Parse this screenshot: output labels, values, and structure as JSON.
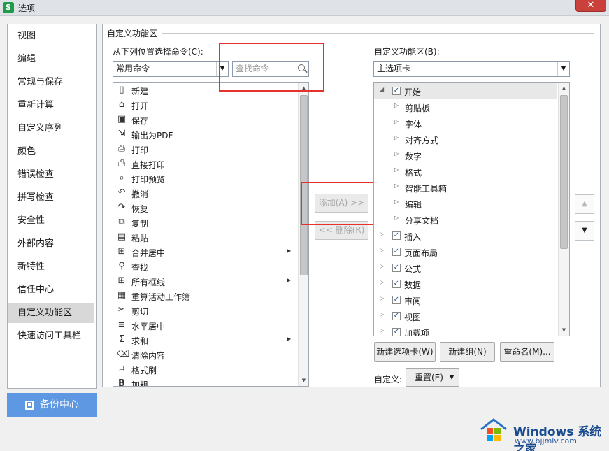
{
  "window": {
    "title": "选项",
    "app_icon": "S",
    "close": "✕"
  },
  "nav": {
    "items": [
      "视图",
      "编辑",
      "常规与保存",
      "重新计算",
      "自定义序列",
      "颜色",
      "错误检查",
      "拼写检查",
      "安全性",
      "外部内容",
      "新特性",
      "信任中心",
      "自定义功能区",
      "快速访问工具栏"
    ],
    "selected": "自定义功能区"
  },
  "backup": {
    "label": "备份中心"
  },
  "section_title": "自定义功能区",
  "left": {
    "label": "从下列位置选择命令(C):",
    "select_value": "常用命令",
    "search_placeholder": "查找命令",
    "commands": [
      {
        "label": "新建",
        "icon": "new-file-icon",
        "submenu": false
      },
      {
        "label": "打开",
        "icon": "open-folder-icon",
        "submenu": false
      },
      {
        "label": "保存",
        "icon": "save-icon",
        "submenu": false
      },
      {
        "label": "输出为PDF",
        "icon": "pdf-export-icon",
        "submenu": false
      },
      {
        "label": "打印",
        "icon": "print-icon",
        "submenu": false
      },
      {
        "label": "直接打印",
        "icon": "quick-print-icon",
        "submenu": false
      },
      {
        "label": "打印预览",
        "icon": "print-preview-icon",
        "submenu": false
      },
      {
        "label": "撤消",
        "icon": "undo-icon",
        "submenu": false
      },
      {
        "label": "恢复",
        "icon": "redo-icon",
        "submenu": false
      },
      {
        "label": "复制",
        "icon": "copy-icon",
        "submenu": false
      },
      {
        "label": "粘贴",
        "icon": "paste-icon",
        "submenu": false
      },
      {
        "label": "合并居中",
        "icon": "merge-center-icon",
        "submenu": true
      },
      {
        "label": "查找",
        "icon": "find-icon",
        "submenu": false
      },
      {
        "label": "所有框线",
        "icon": "all-borders-icon",
        "submenu": true
      },
      {
        "label": "重算活动工作簿",
        "icon": "recalculate-icon",
        "submenu": false
      },
      {
        "label": "剪切",
        "icon": "cut-icon",
        "submenu": false
      },
      {
        "label": "水平居中",
        "icon": "align-center-icon",
        "submenu": false
      },
      {
        "label": "求和",
        "icon": "sum-icon",
        "submenu": true
      },
      {
        "label": "清除内容",
        "icon": "clear-content-icon",
        "submenu": false
      },
      {
        "label": "格式刷",
        "icon": "format-painter-icon",
        "submenu": false
      },
      {
        "label": "加粗",
        "icon": "bold-icon",
        "submenu": false
      }
    ]
  },
  "middle": {
    "add_label": "添加(A) >>",
    "remove_label": "<< 删除(R)"
  },
  "right": {
    "label": "自定义功能区(B):",
    "select_value": "主选项卡",
    "tree": [
      {
        "label": "开始",
        "level": 0,
        "expanded": true,
        "checked": true,
        "highlight": true
      },
      {
        "label": "剪贴板",
        "level": 1
      },
      {
        "label": "字体",
        "level": 1
      },
      {
        "label": "对齐方式",
        "level": 1
      },
      {
        "label": "数字",
        "level": 1
      },
      {
        "label": "格式",
        "level": 1
      },
      {
        "label": "智能工具箱",
        "level": 1
      },
      {
        "label": "编辑",
        "level": 1
      },
      {
        "label": "分享文档",
        "level": 1
      },
      {
        "label": "插入",
        "level": 0,
        "expanded": false,
        "checked": true
      },
      {
        "label": "页面布局",
        "level": 0,
        "expanded": false,
        "checked": true
      },
      {
        "label": "公式",
        "level": 0,
        "expanded": false,
        "checked": true
      },
      {
        "label": "数据",
        "level": 0,
        "expanded": false,
        "checked": true
      },
      {
        "label": "审阅",
        "level": 0,
        "expanded": false,
        "checked": true
      },
      {
        "label": "视图",
        "level": 0,
        "expanded": false,
        "checked": true
      },
      {
        "label": "加载项",
        "level": 0,
        "expanded": false,
        "checked": true
      }
    ],
    "new_tab_label": "新建选项卡(W)",
    "new_group_label": "新建组(N)",
    "rename_label": "重命名(M)...",
    "customize_label": "自定义:",
    "reset_label": "重置(E)"
  },
  "watermark": {
    "title": "Windows 系统之家",
    "url": "www.bjjmlv.com"
  }
}
